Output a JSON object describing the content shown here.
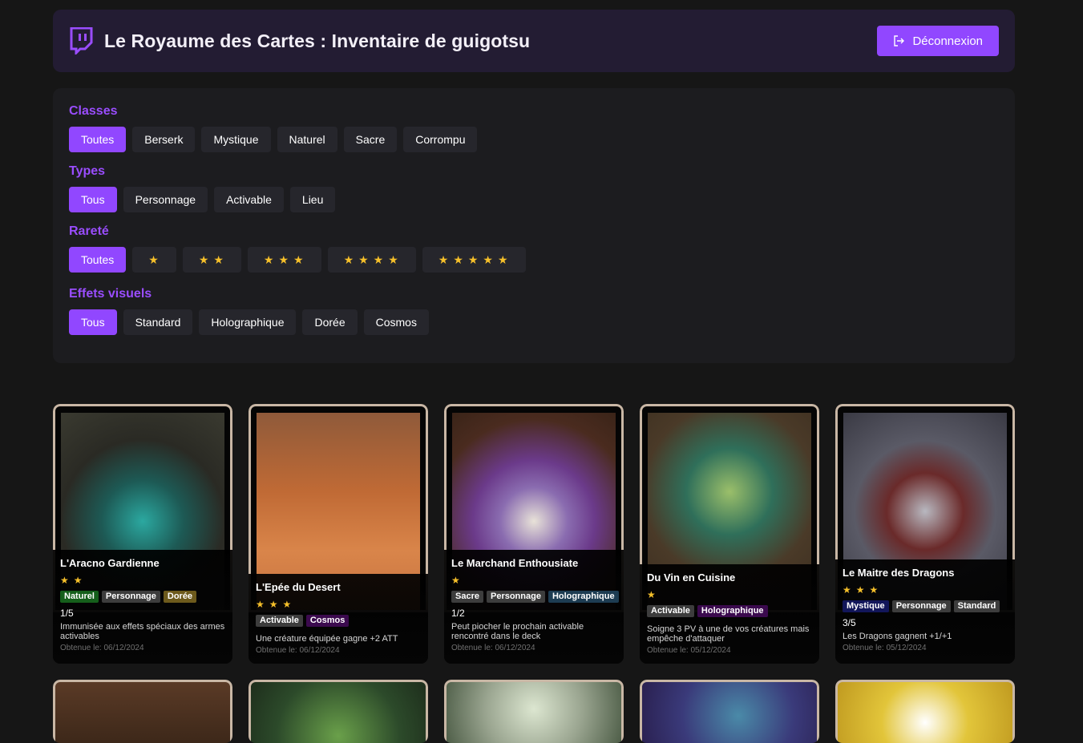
{
  "header": {
    "title": "Le Royaume des Cartes :  Inventaire de guigotsu",
    "logo_icon": "twitch-icon",
    "logout_label": "Déconnexion",
    "logout_icon": "logout-icon"
  },
  "filters": {
    "classes": {
      "title": "Classes",
      "options": [
        "Toutes",
        "Berserk",
        "Mystique",
        "Naturel",
        "Sacre",
        "Corrompu"
      ],
      "selected": "Toutes"
    },
    "types": {
      "title": "Types",
      "options": [
        "Tous",
        "Personnage",
        "Activable",
        "Lieu"
      ],
      "selected": "Tous"
    },
    "rarity": {
      "title": "Rareté",
      "options": [
        "Toutes",
        "★",
        "★★",
        "★★★",
        "★★★★",
        "★★★★★"
      ],
      "selected": "Toutes"
    },
    "effects": {
      "title": "Effets visuels",
      "options": [
        "Tous",
        "Standard",
        "Holographique",
        "Dorée",
        "Cosmos"
      ],
      "selected": "Tous"
    }
  },
  "cards": [
    {
      "name": "L'Aracno Gardienne",
      "stars": "★★",
      "tags": [
        "Naturel",
        "Personnage",
        "Dorée"
      ],
      "count": "1/5",
      "effect": "Immunisée aux effets spéciaux des armes activables",
      "date": "Obtenue le: 06/12/2024",
      "accent": "#2ba8a0"
    },
    {
      "name": "L'Epée du Desert",
      "stars": "★★★",
      "tags": [
        "Activable",
        "Cosmos"
      ],
      "count": "",
      "effect": "Une créature équipée gagne +2 ATT",
      "date": "Obtenue le: 06/12/2024",
      "accent": "#c06a35"
    },
    {
      "name": "Le Marchand Enthousiate",
      "stars": "★",
      "tags": [
        "Sacre",
        "Personnage",
        "Holographique"
      ],
      "count": "1/2",
      "effect": "Peut piocher le prochain activable rencontré dans le deck",
      "date": "Obtenue le: 06/12/2024",
      "accent": "#6b3a8a"
    },
    {
      "name": "Du Vin en Cuisine",
      "stars": "★",
      "tags": [
        "Activable",
        "Holographique"
      ],
      "count": "",
      "effect": "Soigne 3 PV à une de vos créatures mais empêche d'attaquer",
      "date": "Obtenue le: 05/12/2024",
      "accent": "#2f6f5a"
    },
    {
      "name": "Le Maitre des Dragons",
      "stars": "★★★",
      "tags": [
        "Mystique",
        "Personnage",
        "Standard"
      ],
      "count": "3/5",
      "effect": "Les Dragons gagnent +1/+1",
      "date": "Obtenue le: 05/12/2024",
      "accent": "#5a5a66"
    }
  ],
  "row2_accents": [
    "#5a3a26",
    "#2c4a2a",
    "#9aa590",
    "#3a3a7a",
    "#e2c53a"
  ],
  "colors": {
    "accent": "#9147ff",
    "star": "#f6c02a",
    "panel": "#1c1c1f",
    "header_bg": "#231c33"
  }
}
